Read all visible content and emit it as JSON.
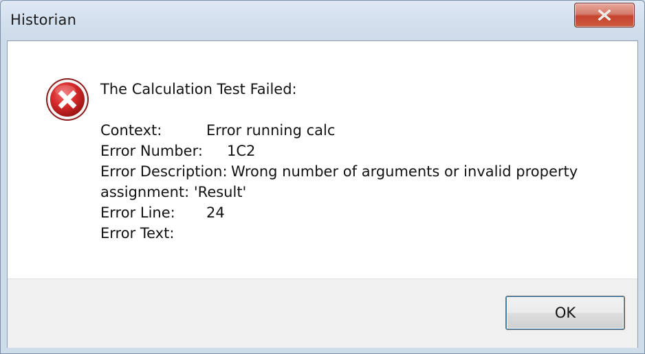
{
  "window": {
    "title": "Historian"
  },
  "icons": {
    "close": "close-icon",
    "error": "error-icon"
  },
  "colors": {
    "error_red": "#c4262e",
    "close_button": "#c4432d"
  },
  "message": {
    "heading": "The Calculation Test Failed:",
    "fields": [
      {
        "label": "Context:",
        "value": "Error running calc"
      },
      {
        "label": "Error Number:",
        "value": "1C2"
      },
      {
        "label": "Error Description:",
        "value": "Wrong number of arguments or invalid property"
      },
      {
        "label": "",
        "value": "assignment: 'Result'"
      },
      {
        "label": "Error Line:",
        "value": "24"
      },
      {
        "label": "Error Text:",
        "value": ""
      }
    ]
  },
  "buttons": {
    "ok_label": "OK"
  }
}
